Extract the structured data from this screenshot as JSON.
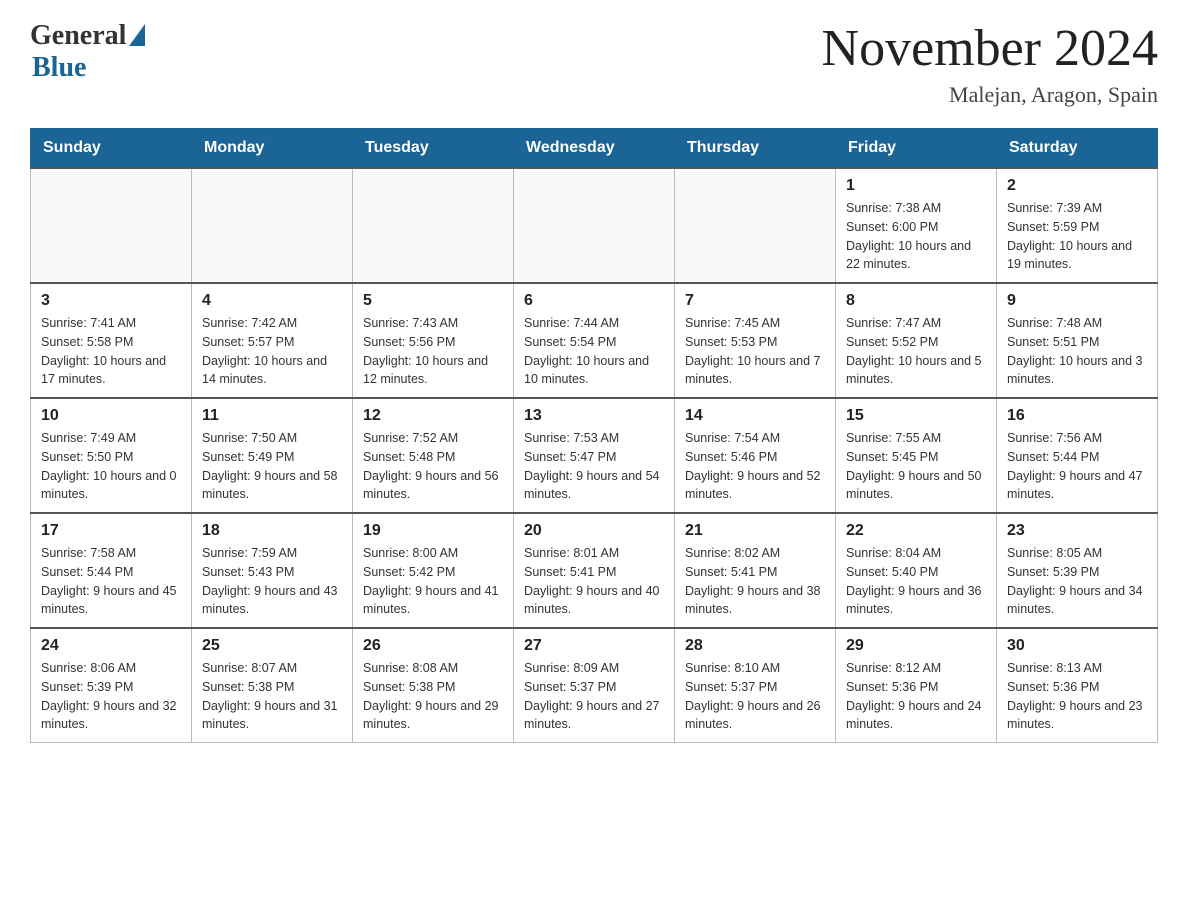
{
  "header": {
    "logo": {
      "general": "General",
      "blue": "Blue"
    },
    "title": "November 2024",
    "location": "Malejan, Aragon, Spain"
  },
  "days_of_week": [
    "Sunday",
    "Monday",
    "Tuesday",
    "Wednesday",
    "Thursday",
    "Friday",
    "Saturday"
  ],
  "weeks": [
    [
      {
        "day": "",
        "info": ""
      },
      {
        "day": "",
        "info": ""
      },
      {
        "day": "",
        "info": ""
      },
      {
        "day": "",
        "info": ""
      },
      {
        "day": "",
        "info": ""
      },
      {
        "day": "1",
        "info": "Sunrise: 7:38 AM\nSunset: 6:00 PM\nDaylight: 10 hours and 22 minutes."
      },
      {
        "day": "2",
        "info": "Sunrise: 7:39 AM\nSunset: 5:59 PM\nDaylight: 10 hours and 19 minutes."
      }
    ],
    [
      {
        "day": "3",
        "info": "Sunrise: 7:41 AM\nSunset: 5:58 PM\nDaylight: 10 hours and 17 minutes."
      },
      {
        "day": "4",
        "info": "Sunrise: 7:42 AM\nSunset: 5:57 PM\nDaylight: 10 hours and 14 minutes."
      },
      {
        "day": "5",
        "info": "Sunrise: 7:43 AM\nSunset: 5:56 PM\nDaylight: 10 hours and 12 minutes."
      },
      {
        "day": "6",
        "info": "Sunrise: 7:44 AM\nSunset: 5:54 PM\nDaylight: 10 hours and 10 minutes."
      },
      {
        "day": "7",
        "info": "Sunrise: 7:45 AM\nSunset: 5:53 PM\nDaylight: 10 hours and 7 minutes."
      },
      {
        "day": "8",
        "info": "Sunrise: 7:47 AM\nSunset: 5:52 PM\nDaylight: 10 hours and 5 minutes."
      },
      {
        "day": "9",
        "info": "Sunrise: 7:48 AM\nSunset: 5:51 PM\nDaylight: 10 hours and 3 minutes."
      }
    ],
    [
      {
        "day": "10",
        "info": "Sunrise: 7:49 AM\nSunset: 5:50 PM\nDaylight: 10 hours and 0 minutes."
      },
      {
        "day": "11",
        "info": "Sunrise: 7:50 AM\nSunset: 5:49 PM\nDaylight: 9 hours and 58 minutes."
      },
      {
        "day": "12",
        "info": "Sunrise: 7:52 AM\nSunset: 5:48 PM\nDaylight: 9 hours and 56 minutes."
      },
      {
        "day": "13",
        "info": "Sunrise: 7:53 AM\nSunset: 5:47 PM\nDaylight: 9 hours and 54 minutes."
      },
      {
        "day": "14",
        "info": "Sunrise: 7:54 AM\nSunset: 5:46 PM\nDaylight: 9 hours and 52 minutes."
      },
      {
        "day": "15",
        "info": "Sunrise: 7:55 AM\nSunset: 5:45 PM\nDaylight: 9 hours and 50 minutes."
      },
      {
        "day": "16",
        "info": "Sunrise: 7:56 AM\nSunset: 5:44 PM\nDaylight: 9 hours and 47 minutes."
      }
    ],
    [
      {
        "day": "17",
        "info": "Sunrise: 7:58 AM\nSunset: 5:44 PM\nDaylight: 9 hours and 45 minutes."
      },
      {
        "day": "18",
        "info": "Sunrise: 7:59 AM\nSunset: 5:43 PM\nDaylight: 9 hours and 43 minutes."
      },
      {
        "day": "19",
        "info": "Sunrise: 8:00 AM\nSunset: 5:42 PM\nDaylight: 9 hours and 41 minutes."
      },
      {
        "day": "20",
        "info": "Sunrise: 8:01 AM\nSunset: 5:41 PM\nDaylight: 9 hours and 40 minutes."
      },
      {
        "day": "21",
        "info": "Sunrise: 8:02 AM\nSunset: 5:41 PM\nDaylight: 9 hours and 38 minutes."
      },
      {
        "day": "22",
        "info": "Sunrise: 8:04 AM\nSunset: 5:40 PM\nDaylight: 9 hours and 36 minutes."
      },
      {
        "day": "23",
        "info": "Sunrise: 8:05 AM\nSunset: 5:39 PM\nDaylight: 9 hours and 34 minutes."
      }
    ],
    [
      {
        "day": "24",
        "info": "Sunrise: 8:06 AM\nSunset: 5:39 PM\nDaylight: 9 hours and 32 minutes."
      },
      {
        "day": "25",
        "info": "Sunrise: 8:07 AM\nSunset: 5:38 PM\nDaylight: 9 hours and 31 minutes."
      },
      {
        "day": "26",
        "info": "Sunrise: 8:08 AM\nSunset: 5:38 PM\nDaylight: 9 hours and 29 minutes."
      },
      {
        "day": "27",
        "info": "Sunrise: 8:09 AM\nSunset: 5:37 PM\nDaylight: 9 hours and 27 minutes."
      },
      {
        "day": "28",
        "info": "Sunrise: 8:10 AM\nSunset: 5:37 PM\nDaylight: 9 hours and 26 minutes."
      },
      {
        "day": "29",
        "info": "Sunrise: 8:12 AM\nSunset: 5:36 PM\nDaylight: 9 hours and 24 minutes."
      },
      {
        "day": "30",
        "info": "Sunrise: 8:13 AM\nSunset: 5:36 PM\nDaylight: 9 hours and 23 minutes."
      }
    ]
  ]
}
